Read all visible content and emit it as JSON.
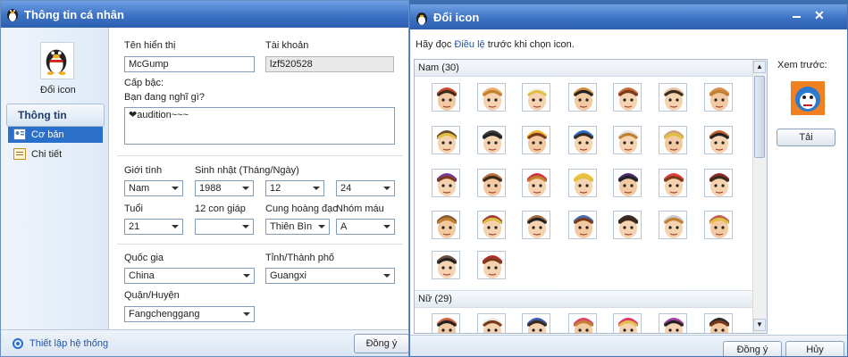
{
  "win1": {
    "title": "Thông tin cá nhân",
    "change_icon": "Đổi icon",
    "nav_header": "Thông tin",
    "nav_items": [
      "Cơ bản",
      "Chi tiết"
    ],
    "display_name_label": "Tên hiển thị",
    "display_name": "McGump",
    "account_label": "Tài khoản",
    "account": "lzf520528",
    "rank_label": "Cấp bậc:",
    "thinking_label": "Bạn đang nghĩ gì?",
    "thinking_text": "❤audition~~~",
    "gender_label": "Giới tính",
    "gender": "Nam",
    "birthday_label": "Sinh nhật (Tháng/Ngày)",
    "birth_year": "1988",
    "birth_month": "12",
    "birth_day": "24",
    "age_label": "Tuổi",
    "age": "21",
    "zodiac_label": "12 con giáp",
    "zodiac": "",
    "constellation_label": "Cung hoàng đạo",
    "constellation": "Thiên Bìn",
    "blood_label": "Nhóm máu",
    "blood": "A",
    "country_label": "Quốc gia",
    "country": "China",
    "province_label": "Tỉnh/Thành phố",
    "province": "Guangxi",
    "district_label": "Quận/Huyện",
    "district": "Fangchenggang",
    "settings": "Thiết lập hệ thống",
    "ok": "Đồng ý"
  },
  "win2": {
    "title": "Đổi icon",
    "instr_pre": "Hãy đọc ",
    "instr_link": "Điều lệ",
    "instr_post": " trước khi chọn icon.",
    "male_group": "Nam (30)",
    "female_group": "Nữ (29)",
    "preview_label": "Xem trước:",
    "load": "Tải",
    "ok": "Đồng ý",
    "cancel": "Hủy"
  },
  "icon_colors": [
    "#c84a2a",
    "#e8b070",
    "#f2f2f2",
    "#d08a3a",
    "#c86a40",
    "#e8c0a0",
    "#d49050",
    "#6a4a2a",
    "#3a3a3a",
    "#f0b030",
    "#2a6ad0",
    "#e0e0e0",
    "#d0a080",
    "#c06030",
    "#7a3a9a",
    "#b87040",
    "#d03040",
    "#f0c040",
    "#4a2a6a",
    "#e04040",
    "#8a2a2a",
    "#8a5a3a",
    "#a0403a",
    "#a06a40",
    "#4a6ab0",
    "#3a2a2a",
    "#c8c8c8",
    "#c06050",
    "#6a5040",
    "#b03030"
  ],
  "female_colors": [
    "#d06040",
    "#e8e8e8",
    "#3a5ab0",
    "#e04070",
    "#e03070",
    "#a040a0",
    "#2a2a2a"
  ]
}
